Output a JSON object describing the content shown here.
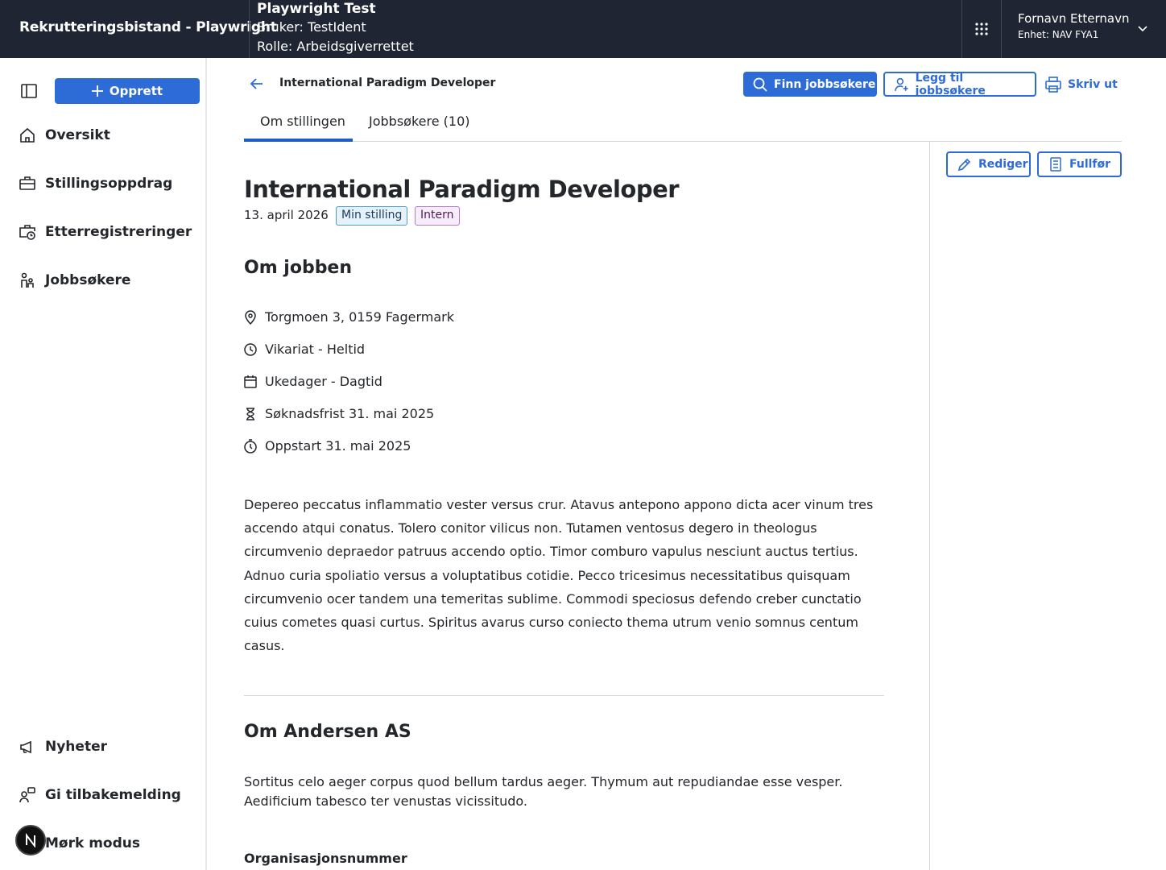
{
  "header": {
    "app_title": "Rekrutteringsbistand - Playwright",
    "env_title": "Playwright Test",
    "env_user": "Bruker: TestIdent",
    "env_role": "Rolle: Arbeidsgiverrettet",
    "user_name": "Fornavn Etternavn",
    "user_unit": "Enhet: NAV FYA1"
  },
  "sidebar": {
    "create_label": "Opprett",
    "items": [
      {
        "label": "Oversikt",
        "icon": "house-icon"
      },
      {
        "label": "Stillingsoppdrag",
        "icon": "briefcase-icon"
      },
      {
        "label": "Etterregistreringer",
        "icon": "briefcase-clock-icon"
      },
      {
        "label": "Jobbsøkere",
        "icon": "people-icon"
      }
    ],
    "bottom_items": [
      {
        "label": "Nyheter",
        "icon": "megaphone-icon"
      },
      {
        "label": "Gi tilbakemelding",
        "icon": "feedback-icon"
      },
      {
        "label": "Mørk modus",
        "icon": "moon-icon"
      }
    ]
  },
  "toolbar": {
    "crumb_title": "International Paradigm Developer",
    "find_label": "Finn jobbsøkere",
    "add_label": "Legg til jobbsøkere",
    "print_label": "Skriv ut"
  },
  "tabs": [
    {
      "label": "Om stillingen",
      "active": true
    },
    {
      "label": "Jobbsøkere (10)",
      "active": false
    }
  ],
  "side_actions": {
    "edit_label": "Rediger",
    "complete_label": "Fullfør"
  },
  "job": {
    "title": "International Paradigm Developer",
    "date": "13. april 2026",
    "tags": [
      "Min stilling",
      "Intern"
    ],
    "about_heading": "Om jobben",
    "facts": [
      {
        "icon": "location-pin-icon",
        "text": "Torgmoen 3, 0159 Fagermark"
      },
      {
        "icon": "clock-icon",
        "text": "Vikariat - Heltid"
      },
      {
        "icon": "calendar-icon",
        "text": "Ukedager - Dagtid"
      },
      {
        "icon": "hourglass-icon",
        "text": "Søknadsfrist 31. mai 2025"
      },
      {
        "icon": "stopwatch-icon",
        "text": "Oppstart 31. mai 2025"
      }
    ],
    "description": "Depereo peccatus inflammatio vester versus crur. Atavus antepono appono dicta acer vinum tres accendo atqui conatus. Tolero conitor vilicus non. Tutamen ventosus degero in theologus circumvenio depraedor patruus accendo optio. Timor comburo vapulus nesciunt auctus tertius. Adnuo curia spoliatio versus a voluptatibus cotidie. Pecco tricesimus necessitatibus quisquam circumvenio ocer tandem una temeritas sublime. Commodi speciosus defendo creber cunctatio cuius cometes quasi curtus. Spiritus avarus curso coniecto thema utrum venio somnus centum casus.",
    "company_heading": "Om Andersen AS",
    "company_description": "Sortitus celo aeger corpus quod bellum tardus aeger. Thymum aut repudiandae esse vesper. Aedificium tabesco ter venustas vicissitudo.",
    "org_heading": "Organisasjonsnummer"
  },
  "colors": {
    "header_bg": "#1f2533",
    "accent": "#2d6bd7",
    "tag_blue_bg": "#e5f1fb",
    "tag_purple_bg": "#f6ecfa"
  }
}
